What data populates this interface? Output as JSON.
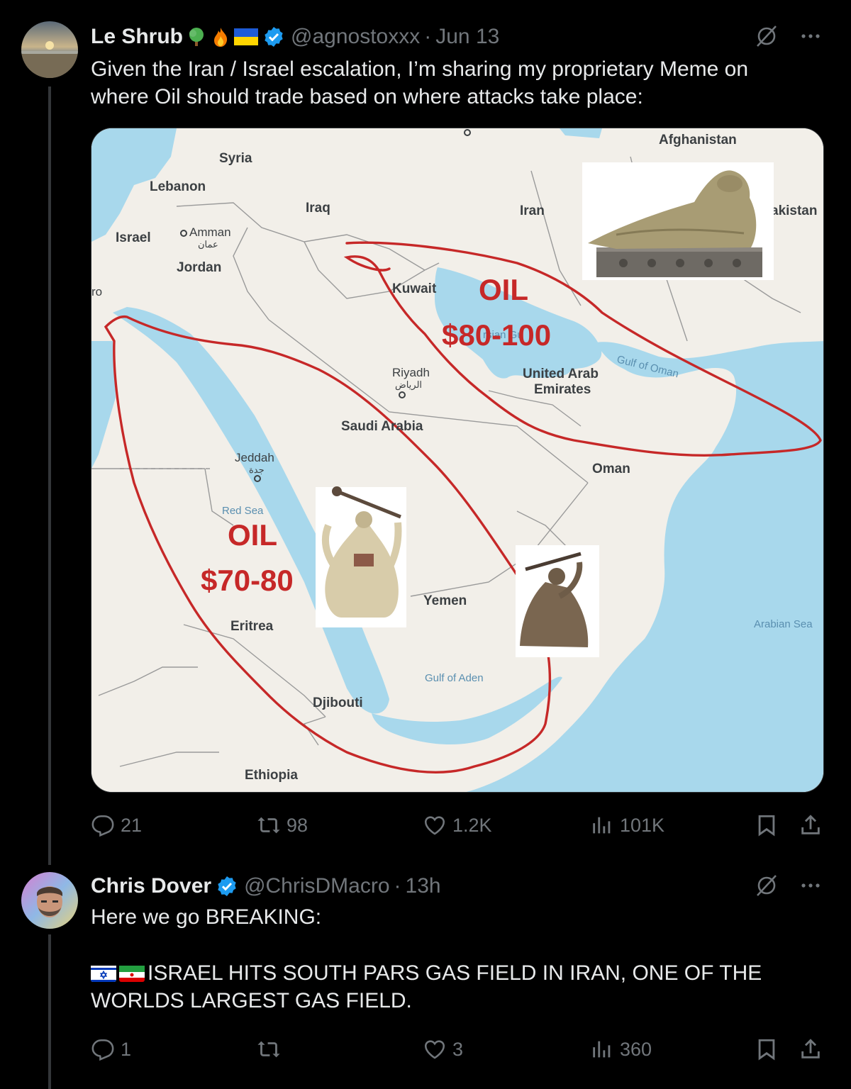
{
  "tweet1": {
    "author_name": "Le Shrub",
    "handle": "@agnostoxxx",
    "separator": "·",
    "time": "Jun 13",
    "text_line1": "Given the Iran / Israel escalation, I’m sharing my proprietary Meme on",
    "text_line2": "where Oil should trade based on where attacks take place:",
    "stats": {
      "replies": "21",
      "reposts": "98",
      "likes": "1.2K",
      "views": "101K"
    },
    "map": {
      "labels": {
        "afghanistan": "Afghanistan",
        "syria": "Syria",
        "lebanon": "Lebanon",
        "iraq": "Iraq",
        "iran": "Iran",
        "pakistan": "akistan",
        "israel": "Israel",
        "amman": "Amman",
        "amman_ar": "عمان",
        "jordan": "Jordan",
        "cairo_partial": "ro",
        "kuwait": "Kuwait",
        "riyadh": "Riyadh",
        "riyadh_ar": "الرياض",
        "uae": "United Arab",
        "uae2": "Emirates",
        "gulf_of_oman": "Gulf of Oman",
        "saudi": "Saudi Arabia",
        "jeddah": "Jeddah",
        "jeddah_ar": "جدة",
        "oman": "Oman",
        "red_sea": "Red Sea",
        "yemen": "Yemen",
        "eritrea": "Eritrea",
        "arabian_sea": "Arabian Sea",
        "gulf_of_aden": "Gulf of Aden",
        "djibouti": "Djibouti",
        "ethiopia": "Ethiopia",
        "persian_gulf_partial": "rsian Gu"
      },
      "annotations": {
        "oil_top": "OIL",
        "price_top": "$80-100",
        "oil_left": "OIL",
        "price_left": "$70-80"
      }
    }
  },
  "tweet2": {
    "author_name": "Chris Dover",
    "handle": "@ChrisDMacro",
    "separator": "·",
    "time": "13h",
    "text_line1": "Here we go BREAKING:",
    "text_line2": "ISRAEL HITS SOUTH PARS GAS FIELD IN IRAN, ONE OF THE",
    "text_line3": "WORLDS LARGEST GAS FIELD.",
    "stats": {
      "replies": "1",
      "reposts": "",
      "likes": "3",
      "views": "360"
    }
  },
  "colors": {
    "background": "#000000",
    "text": "#e7e9ea",
    "muted": "#71767b",
    "verified": "#1d9bf0",
    "annotation_red": "#c62828"
  }
}
